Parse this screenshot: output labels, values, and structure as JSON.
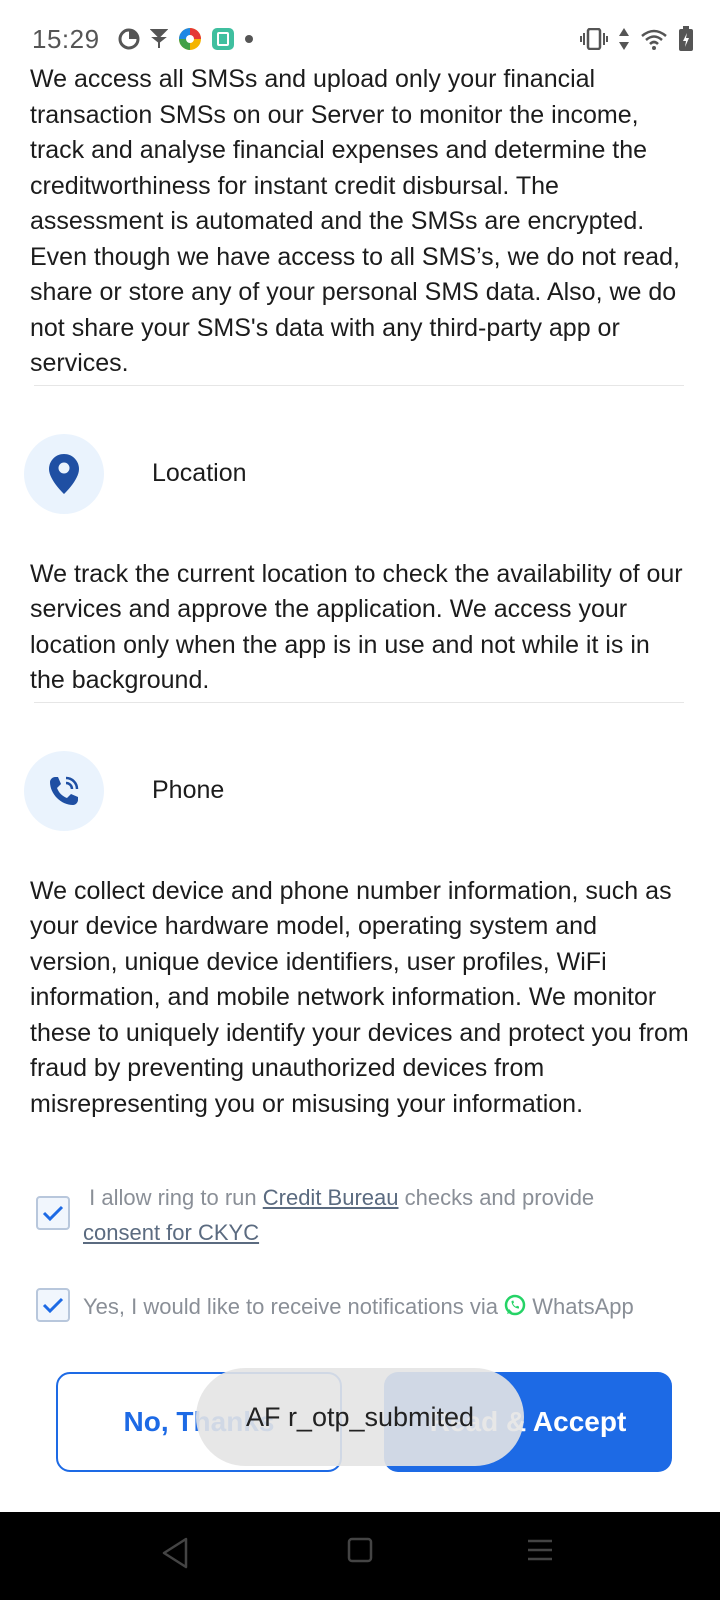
{
  "status_bar": {
    "time": "15:29",
    "left_icons": [
      "data-saver-icon",
      "vpn-icon",
      "colorful-app-icon",
      "green-app-icon",
      "notification-dot-icon"
    ],
    "right_icons": [
      "vibrate-icon",
      "data-arrows-icon",
      "wifi-icon",
      "battery-icon"
    ]
  },
  "sections": {
    "sms_text": "We access all SMSs and upload only your financial transaction SMSs on our Server to monitor the income, track and analyse financial expenses and determine the creditworthiness for instant credit disbursal. The assessment is automated and the SMSs are encrypted. Even though we have access to all SMS’s, we do not read, share or store any of your personal SMS data. Also, we do not share your SMS's data with any third-party app or services.",
    "location": {
      "title": "Location",
      "icon": "location-pin-icon",
      "text": "We track the current location to check the availability of our services and approve the application. We access your location only when the app is in use and not while it is in the background."
    },
    "phone": {
      "title": "Phone",
      "icon": "phone-icon",
      "text": "We collect device and phone number information, such as your device hardware model, operating system and version, unique device identifiers, user profiles, WiFi information, and mobile network information. We monitor these to uniquely identify your devices and protect you from fraud by preventing unauthorized devices from misrepresenting you or misusing your information."
    }
  },
  "consents": {
    "bureau": {
      "checked": true,
      "prefix": " I allow ring to run ",
      "link1": "Credit Bureau",
      "middle": " checks and provide",
      "link2": "consent for CKYC"
    },
    "whatsapp": {
      "checked": true,
      "text": "Yes, I would like to receive notifications via",
      "suffix": "WhatsApp",
      "icon": "whatsapp-icon"
    }
  },
  "buttons": {
    "decline": "No, Thanks",
    "accept": "Read & Accept"
  },
  "toast": "AF r_otp_submited",
  "colors": {
    "accent": "#1d6ae5",
    "icon_blue": "#1f4fa3",
    "icon_bg": "#eaf3fd",
    "whatsapp_green": "#25d366"
  }
}
